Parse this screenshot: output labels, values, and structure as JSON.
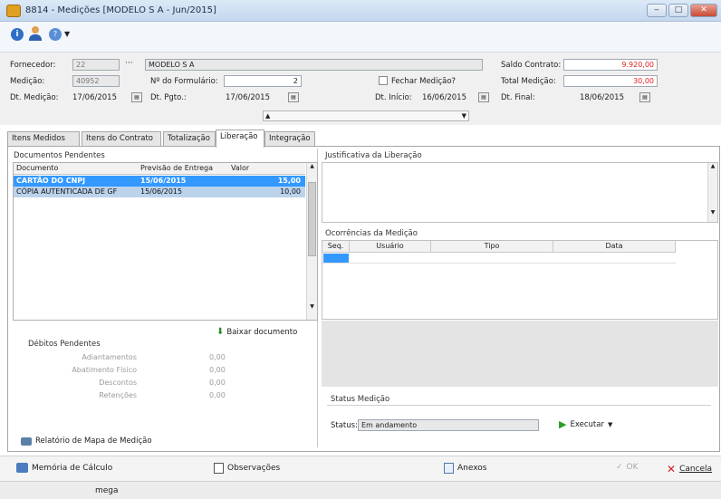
{
  "window": {
    "title": "8814 - Medições [MODELO S A - Jun/2015]",
    "min_glyph": "‒",
    "max_glyph": "□",
    "close_glyph": "✕"
  },
  "form": {
    "fornecedor_label": "Fornecedor:",
    "fornecedor_code": "22",
    "fornecedor_btn": "···",
    "fornecedor_name": "MODELO S A",
    "medicao_label": "Medição:",
    "medicao_value": "40952",
    "formulario_label": "Nº do Formulário:",
    "formulario_value": "2",
    "fechar_label": "Fechar Medição?",
    "dt_medicao_label": "Dt. Medição:",
    "dt_medicao_value": "17/06/2015",
    "dt_pgto_label": "Dt. Pgto.:",
    "dt_pgto_value": "17/06/2015",
    "dt_inicio_label": "Dt. Início:",
    "dt_inicio_value": "16/06/2015",
    "dt_final_label": "Dt. Final:",
    "dt_final_value": "18/06/2015",
    "saldo_label": "Saldo Contrato:",
    "saldo_value": "9.920,00",
    "total_label": "Total Medição:",
    "total_value": "30,00"
  },
  "tabs": [
    "Itens Medidos",
    "Itens do Contrato",
    "Totalização",
    "Liberação",
    "Integração"
  ],
  "docs": {
    "group_title": "Documentos Pendentes",
    "columns": [
      "Documento",
      "Previsão de Entrega",
      "Valor"
    ],
    "rows": [
      {
        "doc": "CARTÃO DO CNPJ",
        "date": "15/06/2015",
        "value": "15,00"
      },
      {
        "doc": "CÓPIA AUTENTICADA DE GF",
        "date": "15/06/2015",
        "value": "10,00"
      }
    ],
    "baixar_label": "Baixar documento"
  },
  "debitos": {
    "title": "Débitos Pendentes",
    "items": [
      {
        "label": "Adiantamentos",
        "value": "0,00"
      },
      {
        "label": "Abatimento Físico",
        "value": "0,00"
      },
      {
        "label": "Descontos",
        "value": "0,00"
      },
      {
        "label": "Retenções",
        "value": "0,00"
      }
    ]
  },
  "relatorio_label": "Relatório de Mapa de Medição",
  "justificativa": {
    "title": "Justificativa da Liberação"
  },
  "ocorrencias": {
    "title": "Ocorrências da Medição",
    "columns": [
      "Seq.",
      "Usuário",
      "Tipo",
      "Data"
    ]
  },
  "status": {
    "group_title": "Status Medição",
    "label": "Status:",
    "value": "Em andamento",
    "executar_label": "Executar"
  },
  "bottom": {
    "memoria": "Memória de Cálculo",
    "observacoes": "Observações",
    "anexos": "Anexos",
    "ok": "OK",
    "cancela": "Cancela"
  },
  "statusbar": {
    "user": "mega"
  },
  "colors": {
    "selection": "#3399ff",
    "saldo_red": "#e02020",
    "execute_green": "#2aa02a",
    "cancel_red": "#d42020"
  }
}
